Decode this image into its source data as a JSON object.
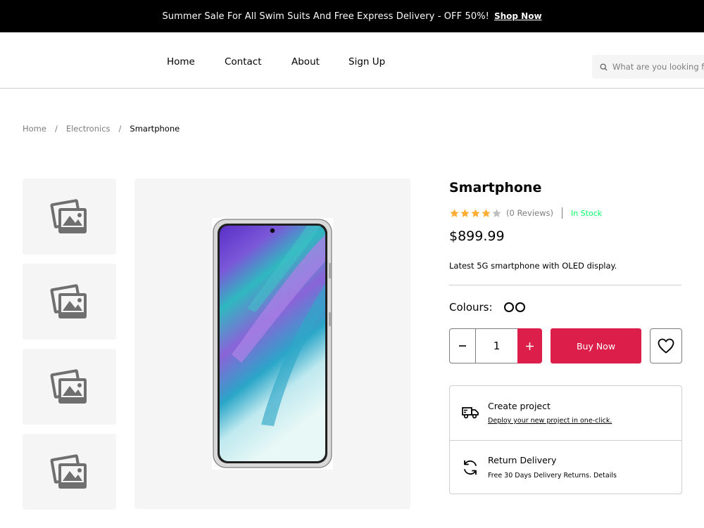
{
  "topbar": {
    "message": "Summer Sale For All Swim Suits And Free Express Delivery - OFF 50%!",
    "link": "Shop Now"
  },
  "nav": {
    "items": [
      "Home",
      "Contact",
      "About",
      "Sign Up"
    ]
  },
  "search": {
    "placeholder": "What are you looking for?"
  },
  "breadcrumb": {
    "items": [
      "Home",
      "Electronics",
      "Smartphone"
    ],
    "separator": "/"
  },
  "product": {
    "title": "Smartphone",
    "rating": 4,
    "rating_max": 5,
    "reviews": "(0 Reviews)",
    "stock": "In Stock",
    "price": "$899.99",
    "description": "Latest 5G smartphone with OLED display.",
    "colours_label": "Colours:",
    "colour_swatch_count": 2,
    "quantity": "1",
    "buy_label": "Buy Now",
    "thumbnail_count": 4
  },
  "services": [
    {
      "icon": "delivery-truck-icon",
      "title": "Create project",
      "subtitle": "Deploy your new project in one-click."
    },
    {
      "icon": "return-arrows-icon",
      "title": "Return Delivery",
      "subtitle": "Free 30 Days Delivery Returns. Details"
    }
  ],
  "colors": {
    "accent": "#db1f4a",
    "star": "#ffad33",
    "star_empty": "#bfbfbf",
    "in_stock": "#00ff66",
    "topbar_bg": "#000000"
  }
}
